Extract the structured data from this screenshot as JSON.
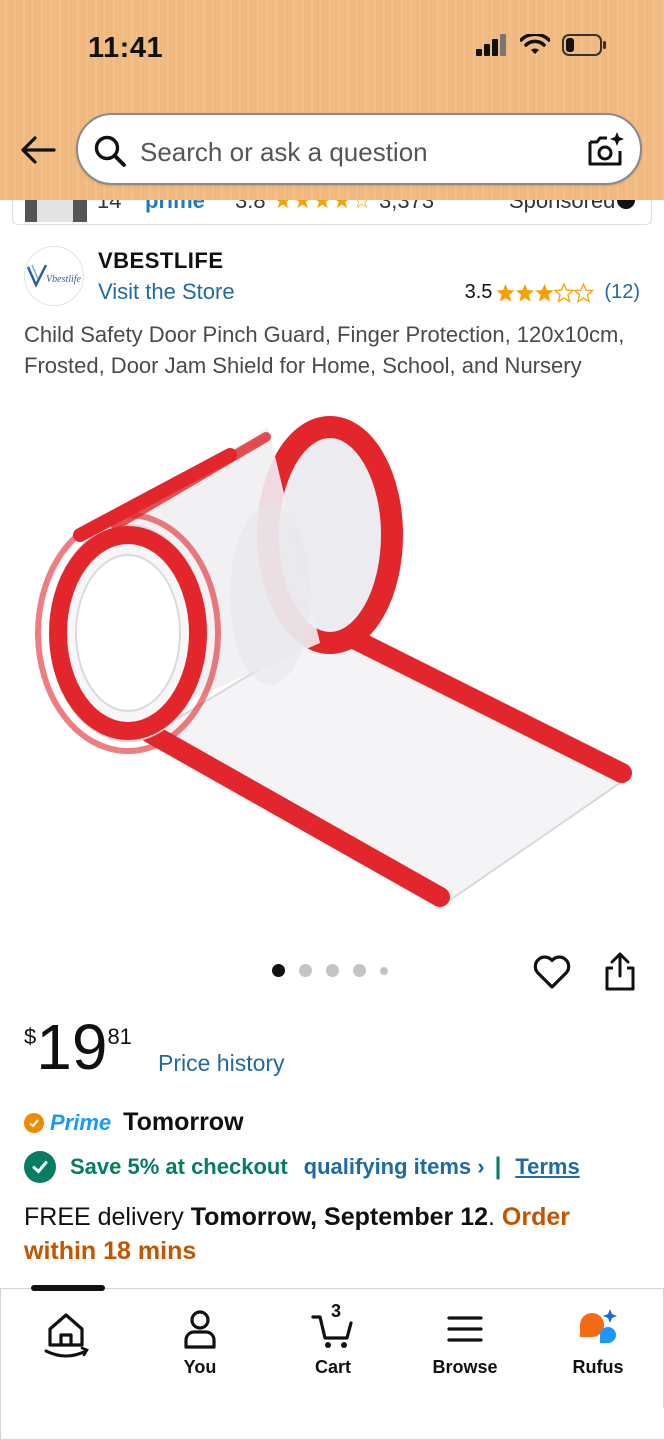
{
  "status_bar": {
    "time": "11:41"
  },
  "search": {
    "placeholder": "Search or ask a question"
  },
  "sponsored": {
    "text_a": "14",
    "text_b": "prime",
    "text_c": "3.8",
    "text_d": "3,373",
    "label": "Sponsored"
  },
  "store": {
    "name": "VBESTLIFE",
    "visit_label": "Visit the Store",
    "logo_text": "Vbestlife",
    "rating_value": "3.5",
    "rating_count": "(12)",
    "rating": 3.5
  },
  "product": {
    "title": "Child Safety Door Pinch Guard, Finger Protection, 120x10cm, Frosted, Door Jam Shield for Home, School, and Nursery"
  },
  "carousel": {
    "image_count": 5,
    "active_index": 0
  },
  "price": {
    "symbol": "$",
    "whole": "19",
    "fraction": "81",
    "history_label": "Price history"
  },
  "prime": {
    "label": "Prime",
    "delivery_day": "Tomorrow"
  },
  "savings": {
    "text": "Save 5% at checkout",
    "qualifying_label": "qualifying items ›",
    "separator": "|",
    "terms_label": "Terms"
  },
  "delivery": {
    "prefix": "FREE delivery ",
    "date": "Tomorrow, September 12",
    "suffix": ". ",
    "order_within": "Order within 18 mins"
  },
  "tabs": [
    {
      "id": "home",
      "label": "",
      "icon": "home-icon"
    },
    {
      "id": "you",
      "label": "You",
      "icon": "person-icon"
    },
    {
      "id": "cart",
      "label": "Cart",
      "icon": "cart-icon",
      "count": "3"
    },
    {
      "id": "browse",
      "label": "Browse",
      "icon": "menu-icon"
    },
    {
      "id": "rufus",
      "label": "Rufus",
      "icon": "rufus-icon"
    }
  ],
  "colors": {
    "header": "#f0bd84",
    "link": "#1f6aa5",
    "green": "#067d62",
    "orange": "#c45500",
    "prime": "#1a98ff",
    "star": "#f7a000",
    "guard_red": "#e3262c"
  }
}
